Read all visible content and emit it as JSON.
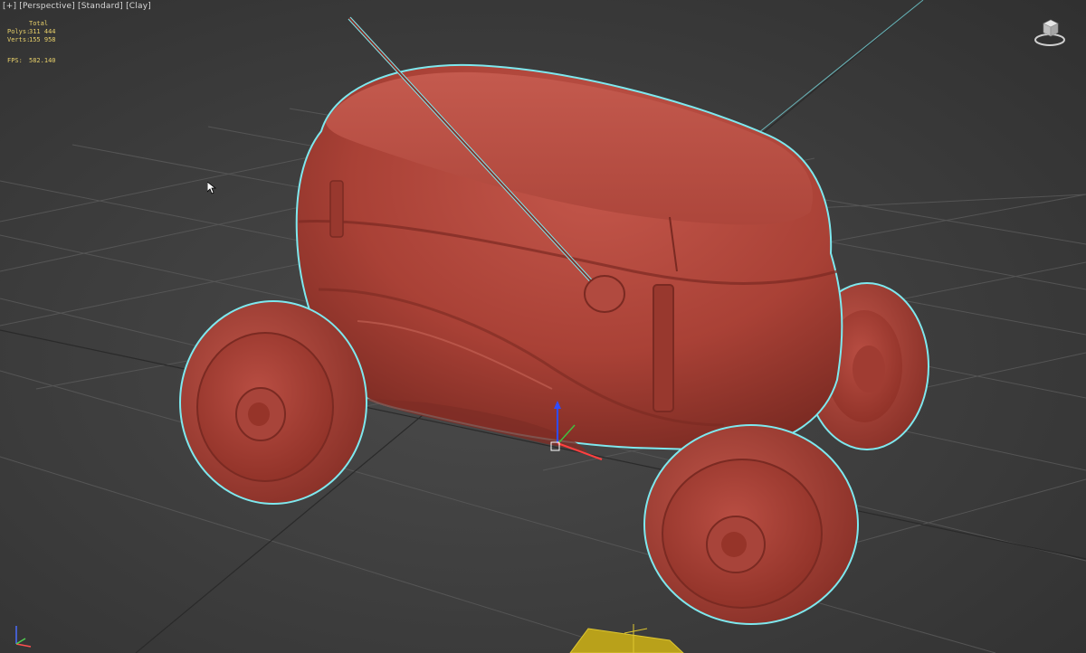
{
  "viewport": {
    "label_parts": [
      "[+]",
      "[Perspective]",
      "[Standard]",
      "[Clay]"
    ],
    "stats": {
      "header": "Total",
      "polys_label": "Polys:",
      "polys_value": "311 444",
      "verts_label": "Verts:",
      "verts_value": "155 958",
      "fps_label": "FPS:",
      "fps_value": "582.140"
    },
    "shading_mode": "Clay",
    "background_color": "#3d3d3d",
    "grid_color": "#5a5a5a",
    "model_color": "#b5463c",
    "selection_outline_color": "#7ee8ee",
    "stats_color": "#e8d06a",
    "icons": [
      "viewcube-icon",
      "axis-tripod-icon",
      "transform-gizmo-icon",
      "mouse-cursor-icon"
    ]
  }
}
